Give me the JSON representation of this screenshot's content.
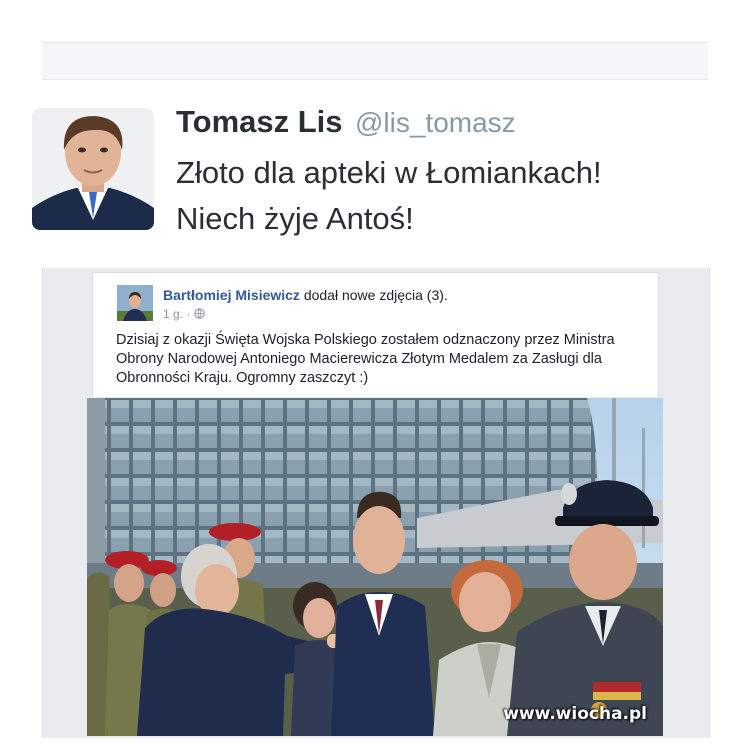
{
  "tweet": {
    "name": "Tomasz Lis",
    "handle": "@lis_tomasz",
    "text_line1": "Złoto dla apteki w Łomiankach!",
    "text_line2": "Niech żyje Antoś!"
  },
  "facebook_post": {
    "author": "Bartłomiej Misiewicz",
    "action": "dodał nowe zdjęcia (3).",
    "time": "1 g. ·",
    "privacy_icon": "globe-icon",
    "text": "Dzisiaj z okazji Święta Wojska Polskiego zostałem odznaczony przez Ministra Obrony Narodowej Antoniego Macierewicza Złotym Medalem za Zasługi dla Obronności Kraju. Ogromny zaszczyt :)"
  },
  "watermark": "www.wiocha.pl",
  "colors": {
    "twitter_text": "#292f33",
    "twitter_handle": "#8899a6",
    "facebook_link": "#365899",
    "facebook_meta": "#90949c",
    "sky": "#aecbe3"
  }
}
